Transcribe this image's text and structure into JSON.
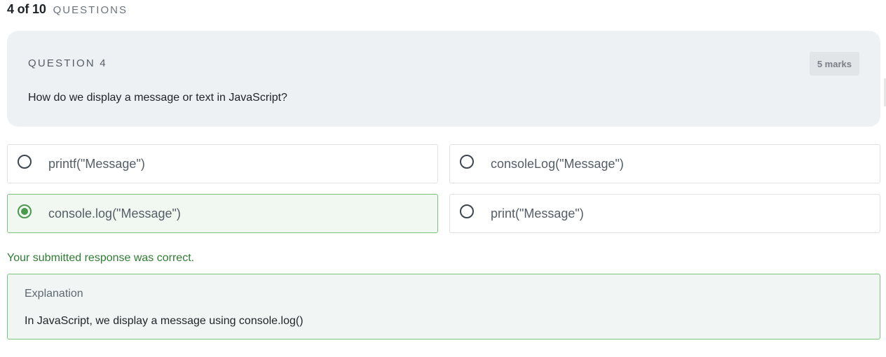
{
  "progress": {
    "count": "4 of 10",
    "label": "QUESTIONS"
  },
  "question": {
    "number_label": "QUESTION 4",
    "marks": "5 marks",
    "text": "How do we display a message or text in JavaScript?"
  },
  "options": [
    {
      "label": "printf(\"Message\")",
      "selected": false
    },
    {
      "label": "consoleLog(\"Message\")",
      "selected": false
    },
    {
      "label": "console.log(\"Message\")",
      "selected": true
    },
    {
      "label": "print(\"Message\")",
      "selected": false
    }
  ],
  "feedback": {
    "text": "Your submitted response was correct."
  },
  "explanation": {
    "title": "Explanation",
    "text": "In JavaScript, we display a message using console.log()"
  },
  "colors": {
    "correct_green": "#2e7d32",
    "selected_border": "#7cc47c",
    "card_background": "#eef1f4"
  }
}
